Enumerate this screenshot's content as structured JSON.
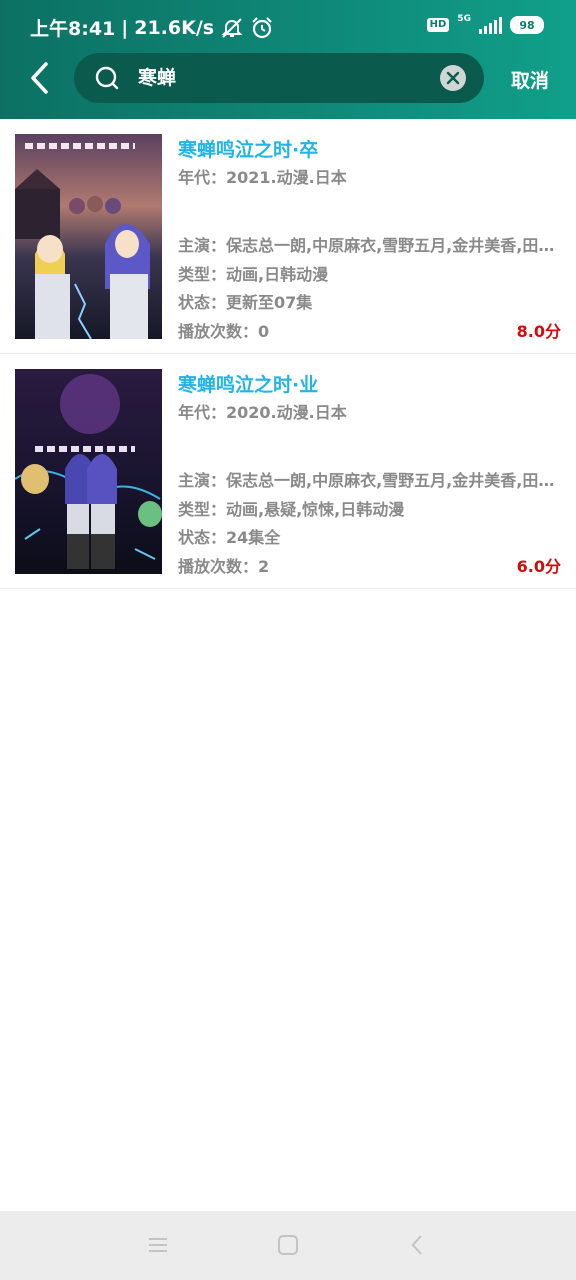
{
  "status_bar": {
    "time": "上午8:41",
    "net_speed": "21.6K/s",
    "hd": "HD",
    "network_type": "5G",
    "battery": "98",
    "icons": [
      "mute-icon",
      "alarm-icon",
      "signal-icon",
      "battery-icon"
    ]
  },
  "search": {
    "query": "寒蝉",
    "cancel_label": "取消"
  },
  "results": [
    {
      "title": "寒蝉鸣泣之时·卒",
      "year": "年代：2021.动漫.日本",
      "cast": "主演：保志总一朗,中原麻衣,雪野五月,金井美香,田村由香里",
      "genre": "类型：动画,日韩动漫",
      "status": "状态：更新至07集",
      "plays": "播放次数：0",
      "rating": "8.0分"
    },
    {
      "title": "寒蝉鸣泣之时·业",
      "year": "年代：2020.动漫.日本",
      "cast": "主演：保志总一朗,中原麻衣,雪野五月,金井美香,田村由香里",
      "genre": "类型：动画,悬疑,惊悚,日韩动漫",
      "status": "状态：24集全",
      "plays": "播放次数：2",
      "rating": "6.0分"
    }
  ],
  "colors": {
    "header_start": "#0c7163",
    "header_end": "#10a08a",
    "title": "#22b4e6",
    "rating": "#d40b0b",
    "meta": "#8a8a8a"
  }
}
